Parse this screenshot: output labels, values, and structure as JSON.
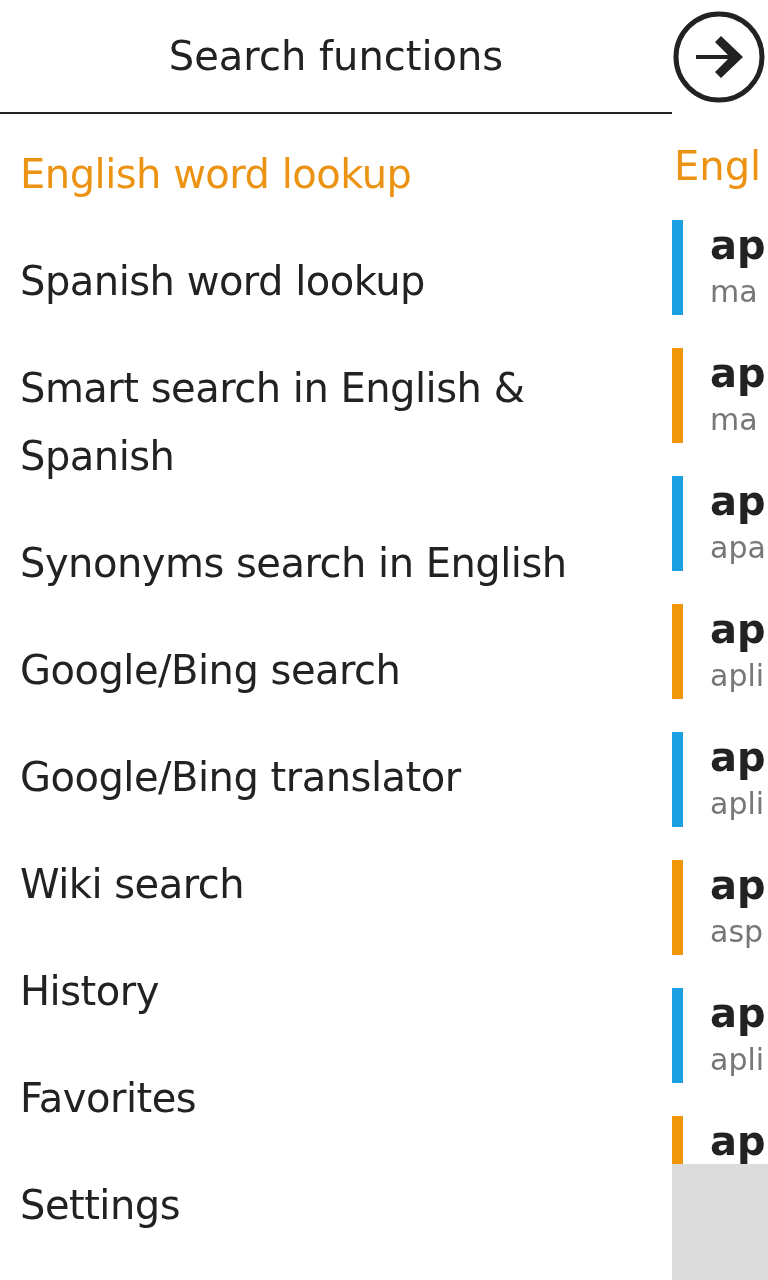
{
  "menu": {
    "title": "Search functions",
    "items": [
      {
        "label": "English word lookup",
        "selected": true
      },
      {
        "label": "Spanish word lookup",
        "selected": false
      },
      {
        "label": "Smart search in English & Spanish",
        "selected": false
      },
      {
        "label": "Synonyms search in English",
        "selected": false
      },
      {
        "label": "Google/Bing search",
        "selected": false
      },
      {
        "label": "Google/Bing translator",
        "selected": false
      },
      {
        "label": "Wiki search",
        "selected": false
      },
      {
        "label": "History",
        "selected": false
      },
      {
        "label": "Favorites",
        "selected": false
      },
      {
        "label": "Settings",
        "selected": false
      }
    ]
  },
  "results": {
    "title": "Engl",
    "items": [
      {
        "word": "ap",
        "translation": "ma",
        "color": "#1ba1e2"
      },
      {
        "word": "ap",
        "translation": "ma",
        "color": "#f09609"
      },
      {
        "word": "ap",
        "translation": "apa",
        "color": "#1ba1e2"
      },
      {
        "word": "ap",
        "translation": "apli",
        "color": "#f09609"
      },
      {
        "word": "ap",
        "translation": "apli",
        "color": "#1ba1e2"
      },
      {
        "word": "ap",
        "translation": "asp",
        "color": "#f09609"
      },
      {
        "word": "ap",
        "translation": "apli",
        "color": "#1ba1e2"
      },
      {
        "word": "ap",
        "color": "#f09609"
      }
    ]
  }
}
